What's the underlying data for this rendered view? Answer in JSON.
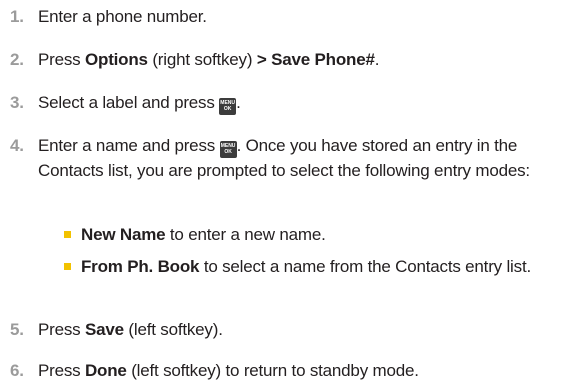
{
  "steps": [
    {
      "num": "1.",
      "text": "Enter a phone number."
    },
    {
      "num": "2.",
      "pre": "Press ",
      "bold1": "Options",
      "mid": " (right softkey) ",
      "bold2": "> Save Phone#",
      "post": "."
    },
    {
      "num": "3.",
      "pre": "Select a label and press ",
      "post": "."
    },
    {
      "num": "4.",
      "pre": "Enter a name and press ",
      "post": ". Once you have stored an entry in the Contacts list, you are prompted to select the following entry modes:"
    },
    {
      "num": "5.",
      "pre": "Press ",
      "bold1": "Save",
      "post": " (left softkey)."
    },
    {
      "num": "6.",
      "pre": "Press ",
      "bold1": "Done",
      "post": " (left softkey) to return to standby mode."
    }
  ],
  "sub_items": [
    {
      "bold": "New Name",
      "text": " to enter a new name."
    },
    {
      "bold": "From Ph. Book",
      "text": " to select a name from the Contacts entry list."
    }
  ],
  "key_icon": {
    "top": "MENU",
    "bottom": "OK",
    "icon": "menu-ok-key-icon"
  },
  "colors": {
    "number": "#9b9b9b",
    "bullet": "#f2c200",
    "text": "#231f20",
    "key": "#3c3c3c"
  }
}
